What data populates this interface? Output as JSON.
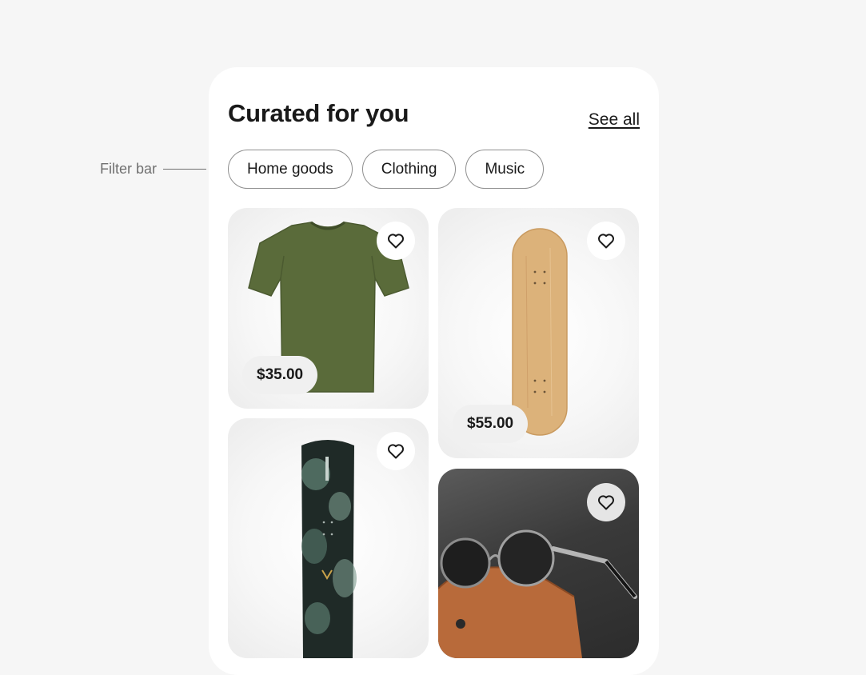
{
  "annotation": {
    "label": "Filter bar"
  },
  "header": {
    "title": "Curated for you",
    "see_all": "See all"
  },
  "filters": [
    "Home goods",
    "Clothing",
    "Music"
  ],
  "products": [
    {
      "name": "Green t-shirt",
      "price": "$35.00",
      "icon": "heart-icon"
    },
    {
      "name": "Skateboard deck",
      "price": "$55.00",
      "icon": "heart-icon"
    },
    {
      "name": "Snowboard",
      "price": "",
      "icon": "heart-icon"
    },
    {
      "name": "Round sunglasses",
      "price": "",
      "icon": "heart-icon"
    }
  ],
  "colors": {
    "background": "#f6f6f6",
    "card": "#ffffff",
    "text": "#191919",
    "chip_border": "#8f8f8f",
    "tshirt": "#5a6b3a",
    "skateboard": "#dcb27a"
  }
}
